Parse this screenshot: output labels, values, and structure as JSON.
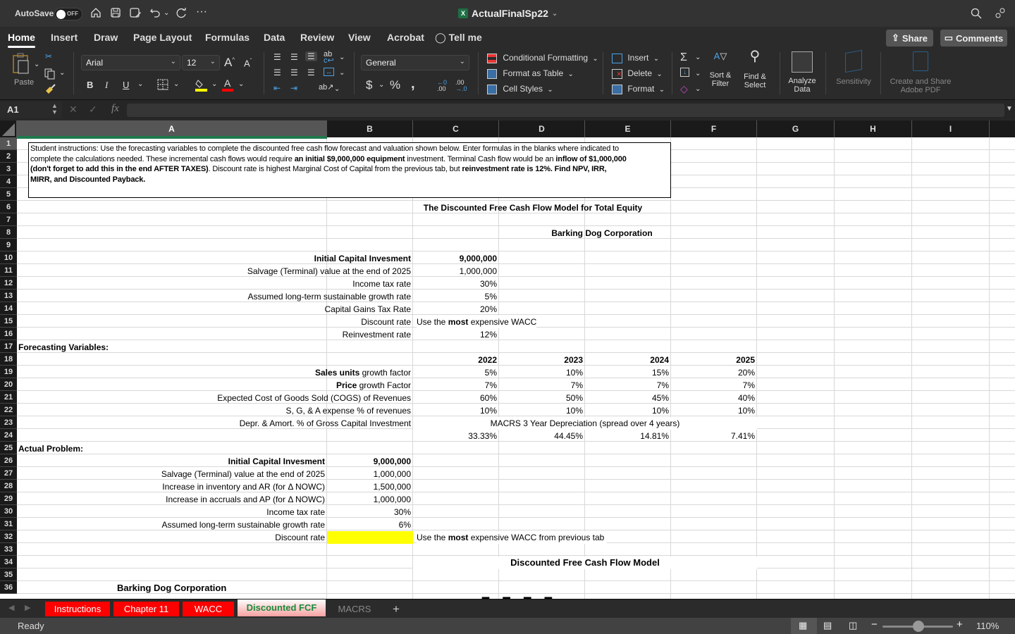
{
  "titlebar": {
    "autosave_label": "AutoSave",
    "autosave_state": "OFF",
    "document_title": "ActualFinalSp22"
  },
  "ribbon_tabs": [
    "Home",
    "Insert",
    "Draw",
    "Page Layout",
    "Formulas",
    "Data",
    "Review",
    "View",
    "Acrobat",
    "Tell me"
  ],
  "active_tab": "Home",
  "top_buttons": {
    "share": "Share",
    "comments": "Comments"
  },
  "ribbon": {
    "paste": "Paste",
    "font_name": "Arial",
    "font_size": "12",
    "number_format": "General",
    "conditional_formatting": "Conditional Formatting",
    "format_as_table": "Format as Table",
    "cell_styles": "Cell Styles",
    "insert": "Insert",
    "delete": "Delete",
    "format": "Format",
    "sort_filter_1": "Sort &",
    "sort_filter_2": "Filter",
    "find_select_1": "Find &",
    "find_select_2": "Select",
    "analyze_1": "Analyze",
    "analyze_2": "Data",
    "sensitivity": "Sensitivity",
    "adobe_1": "Create and Share",
    "adobe_2": "Adobe PDF",
    "fill_color": "#ffff00",
    "font_color": "#ff0000"
  },
  "formula_bar": {
    "name_box": "A1",
    "fx": "fx",
    "formula": ""
  },
  "columns": [
    "A",
    "B",
    "C",
    "D",
    "E",
    "F",
    "G",
    "H",
    "I"
  ],
  "rows": [
    "1",
    "2",
    "3",
    "4",
    "5",
    "6",
    "7",
    "8",
    "9",
    "10",
    "11",
    "12",
    "13",
    "14",
    "15",
    "16",
    "17",
    "18",
    "19",
    "20",
    "21",
    "22",
    "23",
    "24",
    "25",
    "26",
    "27",
    "28",
    "29",
    "30",
    "31",
    "32",
    "33",
    "34",
    "35",
    "36"
  ],
  "instructions": {
    "line1": "Student instructions:  Use the forecasting variables to complete the discounted free cash flow forecast and valuation shown below.  Enter formulas in the blanks where indicated to",
    "line2a": "complete the calculations needed.  These incremental cash flows would require ",
    "line2b": "an initial $9,000,000 equipment",
    "line2c": " investment.  Terminal Cash flow would be an ",
    "line2d": "inflow of $1,000,000",
    "line3a": "(don't forget to add this in the end AFTER TAXES)",
    "line3b": ".  Discount rate is highest Marginal Cost of Capital from the previous tab, but ",
    "line3c": "reinvestment rate is 12%.",
    "line3d": "  Find NPV, IRR,",
    "line4": "MIRR, and Discounted Payback."
  },
  "sheet": {
    "title1": "The Discounted Free Cash Flow Model for Total  Equity",
    "title2": "Barking Dog Corporation",
    "inputs": [
      {
        "label": "Initial Capital Invesment",
        "value": "9,000,000",
        "bold": true
      },
      {
        "label": "Salvage (Terminal) value at the end of 2025",
        "value": "1,000,000"
      },
      {
        "label": "Income tax rate",
        "value": "30%"
      },
      {
        "label": "Assumed long-term sustainable growth rate",
        "value": "5%"
      },
      {
        "label": "Capital Gains Tax Rate",
        "value": "20%"
      },
      {
        "label": "Discount rate",
        "note_a": "Use the ",
        "note_b": "most",
        "note_c": " expensive WACC"
      },
      {
        "label": "Reinvestment rate",
        "value": "12%"
      }
    ],
    "forecasting_header": "Forecasting Variables:",
    "years": [
      "2022",
      "2023",
      "2024",
      "2025"
    ],
    "forecast_rows": [
      {
        "label_bold": "Sales units",
        "label_rest": " growth factor",
        "values": [
          "5%",
          "10%",
          "15%",
          "20%"
        ]
      },
      {
        "label_bold": "Price",
        "label_rest": " growth Factor",
        "values": [
          "7%",
          "7%",
          "7%",
          "7%"
        ]
      },
      {
        "label_bold": "",
        "label_rest": "Expected Cost of Goods Sold (COGS) of Revenues",
        "values": [
          "60%",
          "50%",
          "45%",
          "40%"
        ]
      },
      {
        "label_bold": "",
        "label_rest": "S, G, & A expense % of revenues",
        "values": [
          "10%",
          "10%",
          "10%",
          "10%"
        ]
      }
    ],
    "depr_label": "Depr. & Amort. % of Gross Capital Investment",
    "depr_note": "MACRS 3 Year Depreciation (spread over 4 years)",
    "macrs": [
      "33.33%",
      "44.45%",
      "14.81%",
      "7.41%"
    ],
    "actual_header": "Actual Problem:",
    "actual_inputs": [
      {
        "label": "Initial Capital Invesment",
        "value": "9,000,000",
        "bold": true
      },
      {
        "label": "Salvage (Terminal) value at the end of 2025",
        "value": "1,000,000"
      },
      {
        "label": "Increase in inventory and AR (for Δ NOWC)",
        "value": "1,500,000"
      },
      {
        "label": "Increase in accruals and AP (for Δ NOWC)",
        "value": "1,000,000"
      },
      {
        "label": "Income tax rate",
        "value": "30%"
      },
      {
        "label": "Assumed long-term sustainable growth rate",
        "value": "6%"
      },
      {
        "label": "Discount rate",
        "value": ""
      }
    ],
    "discount_note_a": "Use the ",
    "discount_note_b": "most",
    "discount_note_c": " expensive WACC from previous tab",
    "highlight_color": "#ffff00",
    "dfcf_title": "Discounted Free Cash Flow Model",
    "company2": "Barking Dog Corporation"
  },
  "sheet_tabs": [
    {
      "label": "Instructions",
      "style": "red"
    },
    {
      "label": "Chapter 11",
      "style": "red"
    },
    {
      "label": "WACC",
      "style": "red"
    },
    {
      "label": "Discounted FCF",
      "style": "active"
    },
    {
      "label": "MACRS",
      "style": "plain"
    }
  ],
  "add_sheet": "+",
  "status": {
    "text": "Ready",
    "zoom": "110%",
    "zoom_level_percent": 110
  }
}
